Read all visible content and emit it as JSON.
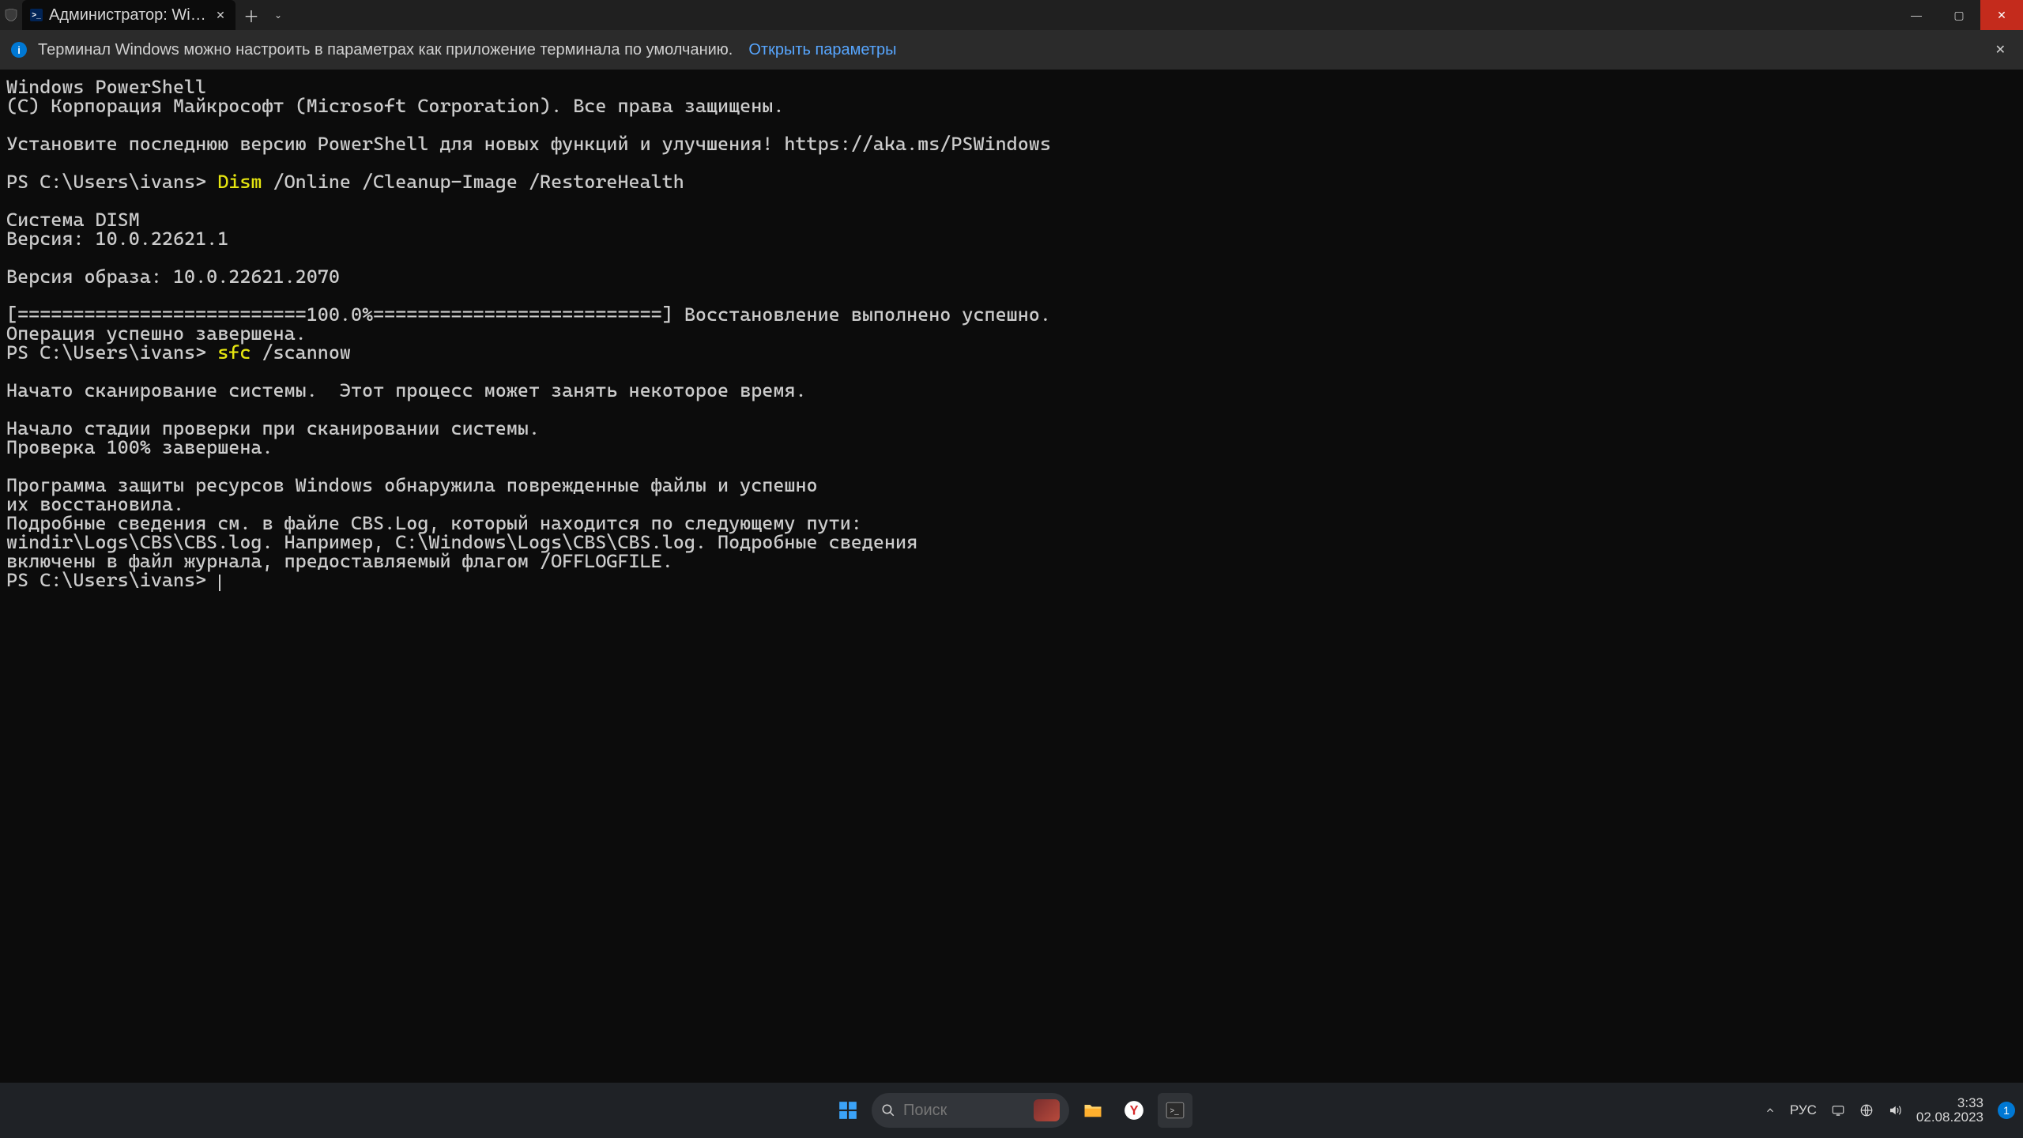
{
  "titlebar": {
    "tab_title": "Администратор: Windows Pc",
    "close_tab": "✕",
    "new_tab": "＋",
    "dropdown": "⌄"
  },
  "winbuttons": {
    "min": "—",
    "max": "▢",
    "close": "✕"
  },
  "notice": {
    "text": "Терминал Windows можно настроить в параметрах как приложение терминала по умолчанию.",
    "link": "Открыть параметры",
    "close": "✕"
  },
  "terminal": {
    "l1": "Windows PowerShell",
    "l2": "(C) Корпорация Майкрософт (Microsoft Corporation). Все права защищены.",
    "l3": "",
    "l4": "Установите последнюю версию PowerShell для новых функций и улучшения! https://aka.ms/PSWindows",
    "l5": "",
    "p1_prompt": "PS C:\\Users\\ivans> ",
    "p1_cmd": "Dism",
    "p1_args": " /Online /Cleanup-Image /RestoreHealth",
    "l7": "",
    "l8": "Cистема DISM",
    "l9": "Версия: 10.0.22621.1",
    "l10": "",
    "l11": "Версия образа: 10.0.22621.2070",
    "l12": "",
    "l13": "[==========================100.0%==========================] Восстановление выполнено успешно.",
    "l14": "Операция успешно завершена.",
    "p2_prompt": "PS C:\\Users\\ivans> ",
    "p2_cmd": "sfc",
    "p2_args": " /scannow",
    "l16": "",
    "l17": "Начато сканирование системы.  Этот процесс может занять некоторое время.",
    "l18": "",
    "l19": "Начало стадии проверки при сканировании системы.",
    "l20": "Проверка 100% завершена.",
    "l21": "",
    "l22": "Программа защиты ресурсов Windows обнаружила поврежденные файлы и успешно",
    "l23": "их восстановила.",
    "l24": "Подробные сведения см. в файле CBS.Log, который находится по следующему пути:",
    "l25": "windir\\Logs\\CBS\\CBS.log. Например, C:\\Windows\\Logs\\CBS\\CBS.log. Подробные сведения",
    "l26": "включены в файл журнала, предоставляемый флагом /OFFLOGFILE.",
    "p3_prompt": "PS C:\\Users\\ivans> "
  },
  "taskbar": {
    "search_placeholder": "Поиск",
    "lang": "РУС",
    "time": "3:33",
    "date": "02.08.2023",
    "notif_count": "1"
  }
}
